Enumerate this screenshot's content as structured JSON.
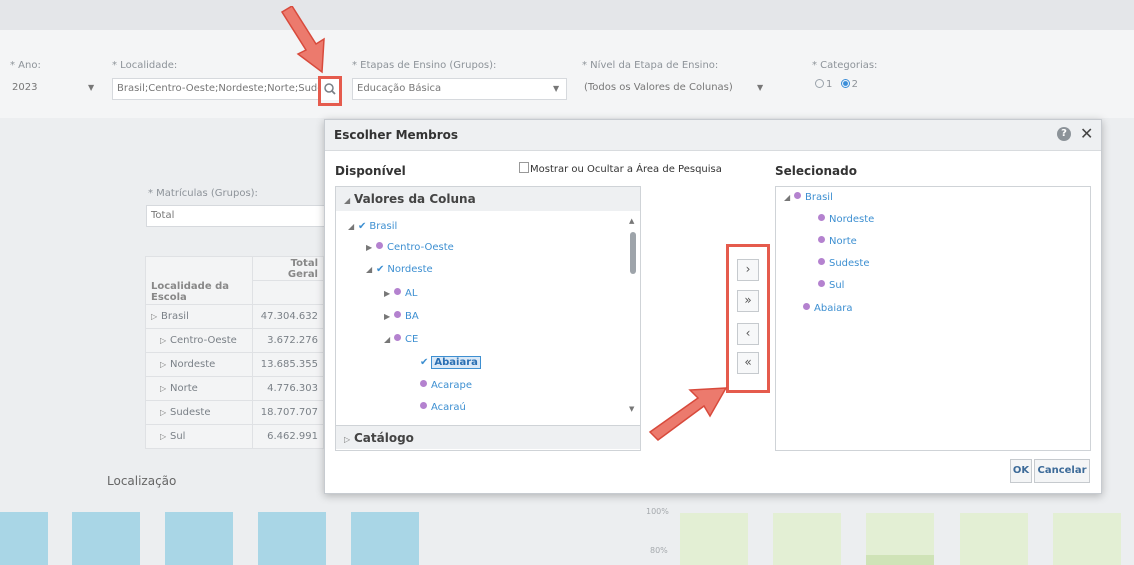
{
  "params": {
    "ano": {
      "label": "* Ano:",
      "value": "2023"
    },
    "localidade": {
      "label": "* Localidade:",
      "value": "Brasil;Centro-Oeste;Nordeste;Norte;Sudes"
    },
    "etapas": {
      "label": "* Etapas de Ensino (Grupos):",
      "value": "Educação Básica"
    },
    "nivel": {
      "label": "* Nível da Etapa de Ensino:",
      "value": "(Todos os Valores de Colunas)"
    },
    "categorias": {
      "label": "* Categorias:",
      "opt1": "1",
      "opt2": "2",
      "selected": "2"
    }
  },
  "report": {
    "matriculas_label": "* Matrículas (Grupos):",
    "matriculas_value": "Total",
    "total_header": "Total Geral",
    "row_header": "Localidade da Escola",
    "rows": [
      {
        "name": "Brasil",
        "value": "47.304.632"
      },
      {
        "name": "Centro-Oeste",
        "value": "3.672.276"
      },
      {
        "name": "Nordeste",
        "value": "13.685.355"
      },
      {
        "name": "Norte",
        "value": "4.776.303"
      },
      {
        "name": "Sudeste",
        "value": "18.707.707"
      },
      {
        "name": "Sul",
        "value": "6.462.991"
      }
    ],
    "localizacao": "Localização",
    "pct100": "100%",
    "pct80": "80%"
  },
  "dialog": {
    "title": "Escolher Membros",
    "disponivel": "Disponível",
    "toggle_search": "Mostrar ou Ocultar a Área de Pesquisa",
    "selecionado": "Selecionado",
    "valores_coluna": "Valores da Coluna",
    "catalogo": "Catálogo",
    "tree": {
      "brasil": "Brasil",
      "centro_oeste": "Centro-Oeste",
      "nordeste": "Nordeste",
      "al": "AL",
      "ba": "BA",
      "ce": "CE",
      "abaiara": "Abaiara",
      "acarape": "Acarape",
      "acarau": "Acaraú"
    },
    "selected": {
      "brasil": "Brasil",
      "nordeste": "Nordeste",
      "norte": "Norte",
      "sudeste": "Sudeste",
      "sul": "Sul",
      "abaiara": "Abaiara"
    },
    "buttons": {
      "move": "›",
      "move_all": "»",
      "remove": "‹",
      "remove_all": "«",
      "ok": "OK",
      "cancel": "Cancelar"
    },
    "help": "?",
    "close": "✕"
  },
  "colors": {
    "annotation": "#e55b4d",
    "accent": "#3d8fd1",
    "member_dot": "#b482cf"
  }
}
